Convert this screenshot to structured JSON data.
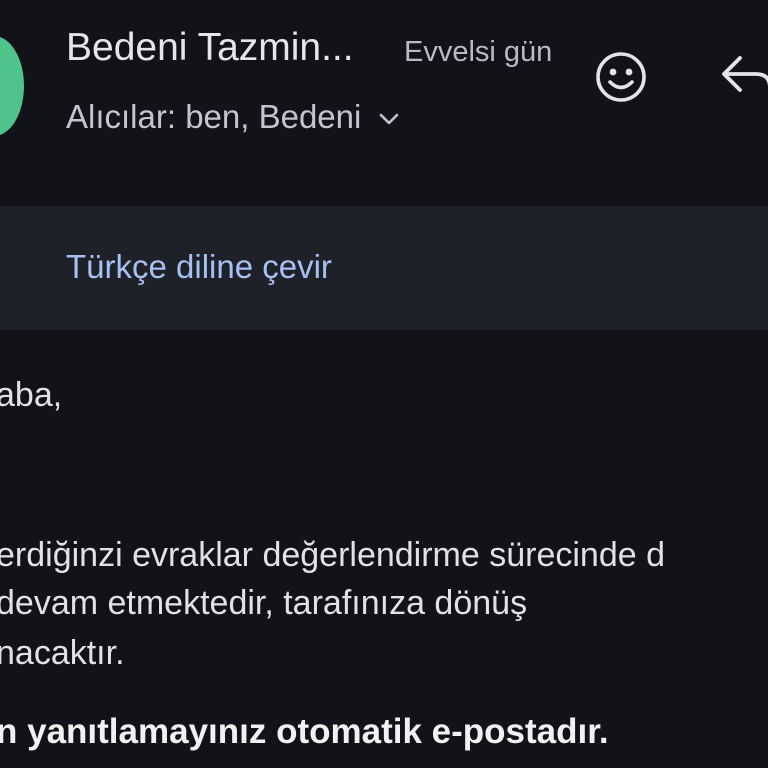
{
  "header": {
    "sender_name": "Bedeni Tazmin...",
    "date": "Evvelsi gün",
    "recipients": "Alıcılar: ben, Bedeni",
    "avatar_color": "#4ec38a",
    "icons": [
      "emoji-reaction-icon",
      "reply-icon",
      "chevron-down-icon"
    ]
  },
  "translate": {
    "link_label": "Türkçe diline çevir",
    "link_color": "#a6c0f2"
  },
  "message": {
    "greeting": "aba,",
    "line1": "erdiğinzi evraklar değerlendirme sürecinde d",
    "line2": " devam etmektedir, tarafınıza dönüş",
    "line3": "nacaktır.",
    "bold_line": "n yanıtlamayınız otomatik e-postadır."
  },
  "colors": {
    "background": "#121318",
    "banner": "#1f2128"
  }
}
